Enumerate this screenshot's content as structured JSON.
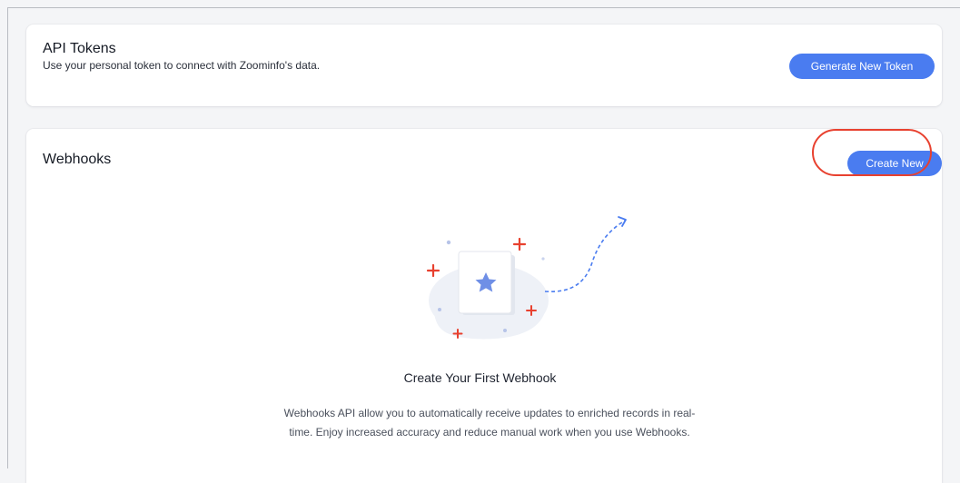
{
  "api_tokens": {
    "title": "API Tokens",
    "description": "Use your personal token to connect with Zoominfo's data.",
    "generate_label": "Generate New Token"
  },
  "webhooks": {
    "title": "Webhooks",
    "create_label": "Create New",
    "empty_state": {
      "title": "Create Your First Webhook",
      "description": "Webhooks API allow you to automatically receive updates to enriched records in real-time. Enjoy increased accuracy and reduce manual work when you use Webhooks."
    }
  },
  "colors": {
    "primary_button": "#4a7cf0",
    "highlight_ring": "#e8412f",
    "plus_icon": "#e8412f",
    "star_icon": "#6f8fe6"
  }
}
